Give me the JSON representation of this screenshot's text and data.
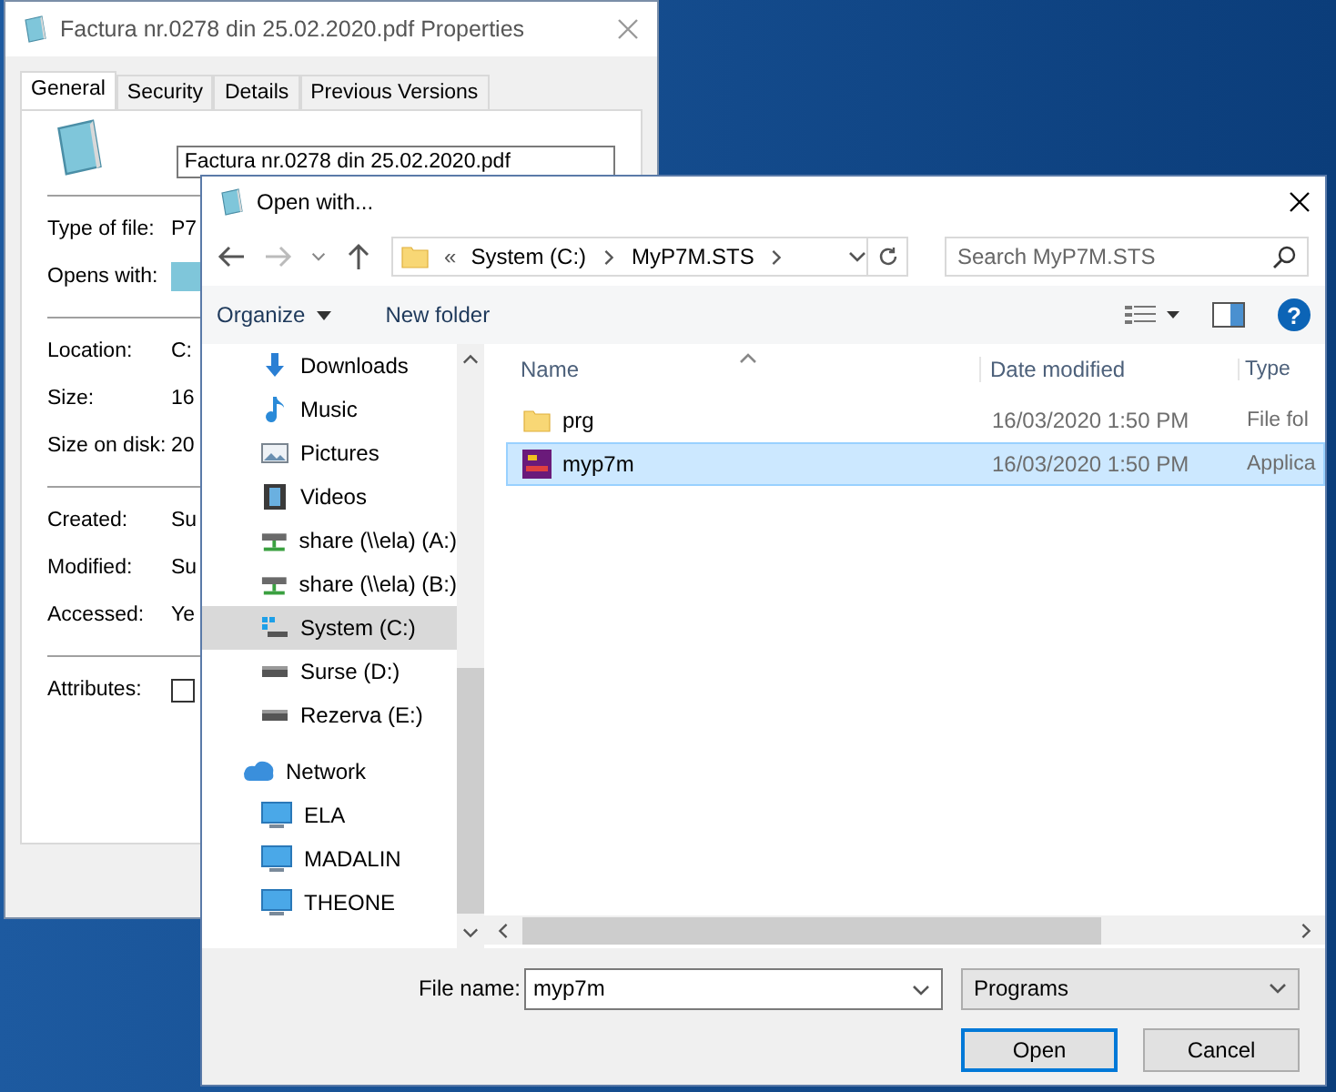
{
  "properties_window": {
    "title": "Factura nr.0278 din 25.02.2020.pdf Properties",
    "tabs": [
      {
        "label": "General",
        "selected": true
      },
      {
        "label": "Security",
        "selected": false
      },
      {
        "label": "Details",
        "selected": false
      },
      {
        "label": "Previous Versions",
        "selected": false
      }
    ],
    "file_name": "Factura nr.0278 din 25.02.2020.pdf",
    "groups": [
      [
        {
          "label": "Type of file:",
          "kind": "text",
          "value": "P7"
        },
        {
          "label": "Opens with:",
          "kind": "app"
        }
      ],
      [
        {
          "label": "Location:",
          "kind": "text",
          "value": "C:"
        },
        {
          "label": "Size:",
          "kind": "text",
          "value": "16"
        },
        {
          "label": "Size on disk:",
          "kind": "text",
          "value": "20"
        }
      ],
      [
        {
          "label": "Created:",
          "kind": "text",
          "value": "Su"
        },
        {
          "label": "Modified:",
          "kind": "text",
          "value": "Su"
        },
        {
          "label": "Accessed:",
          "kind": "text",
          "value": "Ye"
        }
      ],
      [
        {
          "label": "Attributes:",
          "kind": "checkbox",
          "checked": false
        }
      ]
    ]
  },
  "open_with": {
    "title": "Open with...",
    "address": {
      "overflow": "«",
      "crumbs": [
        "System (C:)",
        "MyP7M.STS"
      ]
    },
    "search": {
      "placeholder": "Search MyP7M.STS"
    },
    "toolbar": [
      "Organize",
      "New folder"
    ],
    "help": "?",
    "navigation": [
      {
        "label": "Downloads",
        "kind": "download",
        "selected": false
      },
      {
        "label": "Music",
        "kind": "music",
        "selected": false
      },
      {
        "label": "Pictures",
        "kind": "pictures",
        "selected": false
      },
      {
        "label": "Videos",
        "kind": "videos",
        "selected": false
      },
      {
        "label": "share (\\\\ela) (A:)",
        "kind": "netdrive",
        "selected": false
      },
      {
        "label": "share (\\\\ela) (B:)",
        "kind": "netdrive",
        "selected": false
      },
      {
        "label": "System (C:)",
        "kind": "system",
        "selected": true
      },
      {
        "label": "Surse (D:)",
        "kind": "drive",
        "selected": false
      },
      {
        "label": "Rezerva (E:)",
        "kind": "drive",
        "selected": false
      },
      {
        "label": "Network",
        "kind": "network",
        "selected": false,
        "children": [
          {
            "label": "ELA",
            "kind": "computer",
            "selected": false
          },
          {
            "label": "MADALIN",
            "kind": "computer",
            "selected": false
          },
          {
            "label": "THEONE",
            "kind": "computer",
            "selected": false
          }
        ]
      }
    ],
    "columns": [
      "Name",
      "Date modified",
      "Type"
    ],
    "rows": [
      {
        "name": "prg",
        "kind": "folder",
        "date": "16/03/2020 1:50 PM",
        "type": "File fol",
        "selected": false
      },
      {
        "name": "myp7m",
        "kind": "app",
        "date": "16/03/2020 1:50 PM",
        "type": "Applica",
        "selected": true
      }
    ],
    "file_name": {
      "label": "File name:",
      "value": "myp7m"
    },
    "file_type": "Programs",
    "buttons": [
      {
        "label": "Open",
        "default": true
      },
      {
        "label": "Cancel",
        "default": false
      }
    ]
  }
}
